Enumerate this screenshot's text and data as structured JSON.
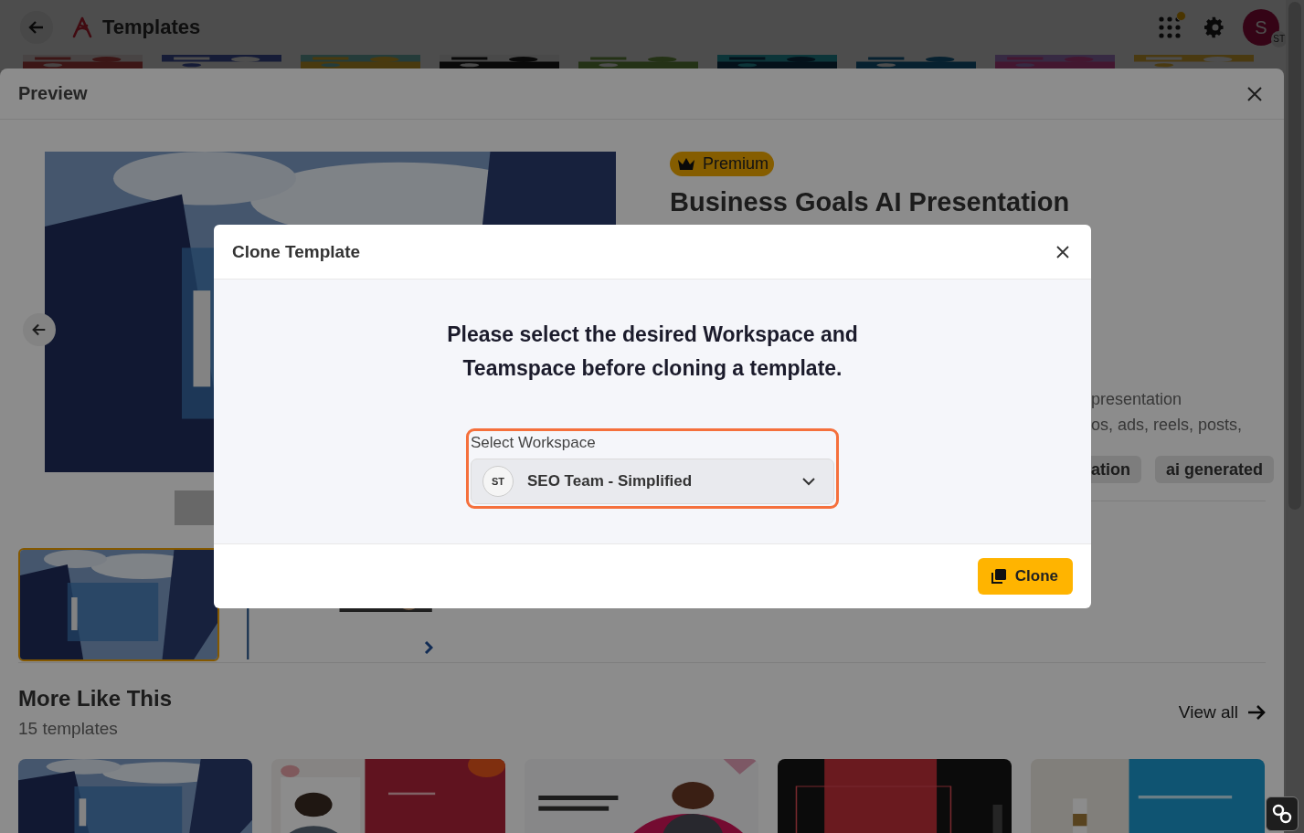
{
  "header": {
    "title": "Templates",
    "apps_notification": true,
    "avatar_initial": "S",
    "avatar_badge": "ST"
  },
  "template_strip": [
    {
      "kind": "picture"
    },
    {
      "kind": "picture"
    },
    {
      "kind": "picture"
    },
    {
      "kind": "picture"
    },
    {
      "kind": "picture"
    },
    {
      "kind": "picture"
    },
    {
      "kind": "picture"
    },
    {
      "kind": "picture"
    },
    {
      "kind": "picture"
    }
  ],
  "preview": {
    "title": "Preview",
    "main_slide": {
      "kind": "picture"
    },
    "slides": [
      {
        "kind": "picture",
        "selected": true
      },
      {
        "kind": "picture",
        "selected": false
      }
    ],
    "badge": "Premium",
    "template_title": "Business Goals AI Presentation",
    "description_lines": [
      "presentation",
      "os, ads, reels, posts,"
    ],
    "tags": [
      "ation",
      "ai generated"
    ],
    "more": {
      "title": "More Like This",
      "count": "15 templates",
      "link": "View all",
      "cards": [
        {
          "kind": "picture"
        },
        {
          "kind": "picture"
        },
        {
          "kind": "picture"
        },
        {
          "kind": "picture"
        },
        {
          "kind": "picture"
        }
      ]
    }
  },
  "dialog": {
    "title": "Clone Template",
    "message": "Please select the desired Workspace and Teamspace before cloning a template.",
    "field": {
      "label": "Select Workspace",
      "initials": "ST",
      "value": "SEO Team - Simplified",
      "highlighted": true
    },
    "button": "Clone"
  }
}
